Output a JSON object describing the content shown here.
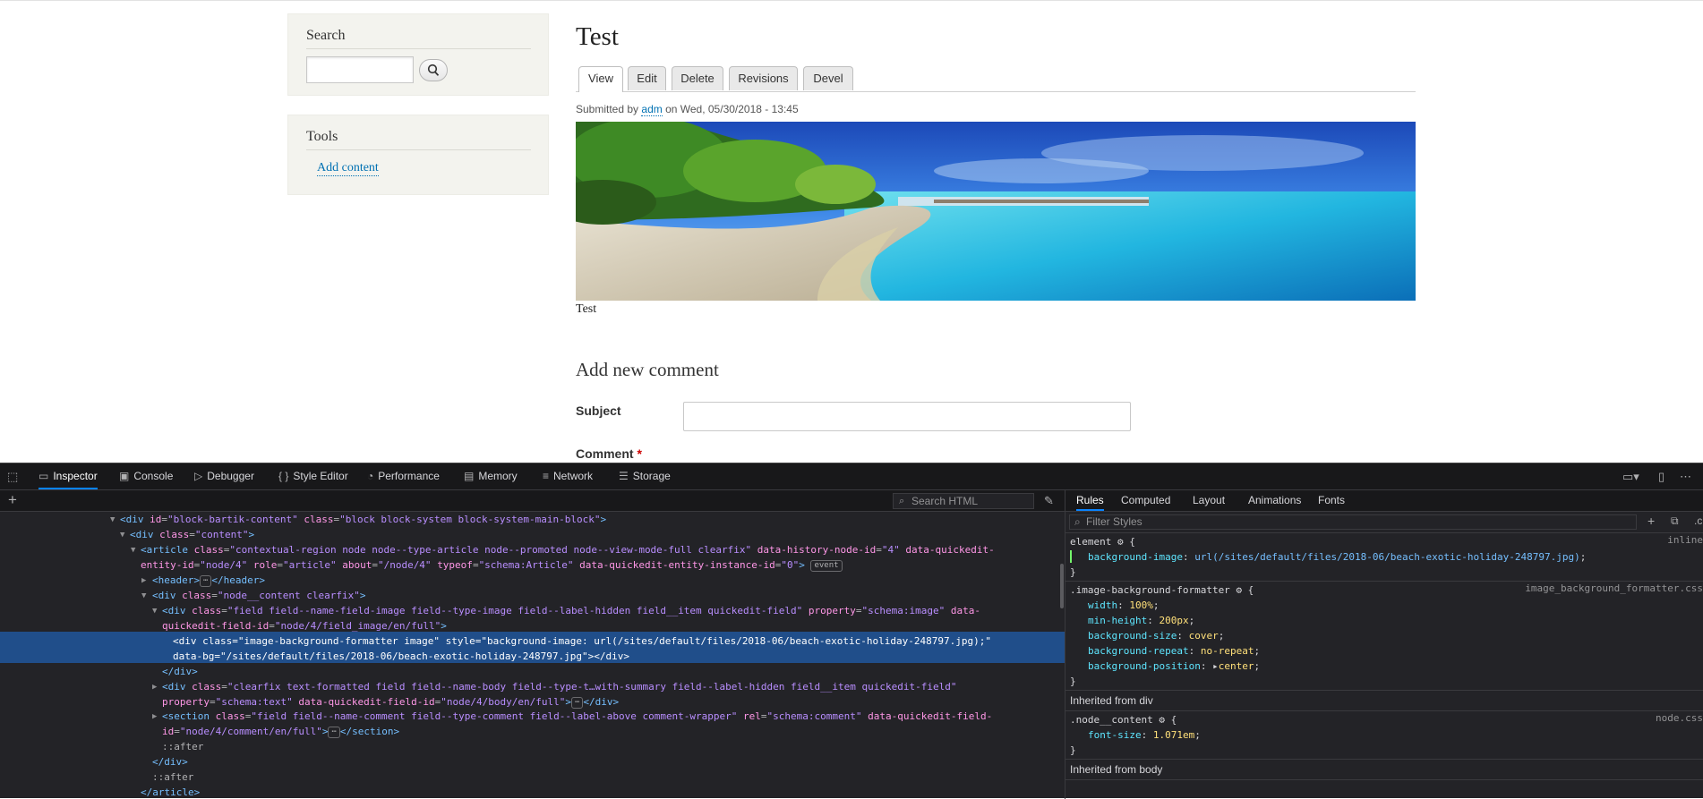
{
  "page": {
    "search_block": {
      "title": "Search"
    },
    "tools_block": {
      "title": "Tools",
      "add_content_link": "Add content"
    },
    "title": "Test",
    "tabs": [
      "View",
      "Edit",
      "Delete",
      "Revisions",
      "Devel"
    ],
    "submitted": {
      "prefix": "Submitted by",
      "author": "adm",
      "suffix": "on Wed, 05/30/2018 - 13:45"
    },
    "image_caption": "Test",
    "comment_form": {
      "title": "Add new comment",
      "subject_label": "Subject",
      "comment_label": "Comment",
      "required_marker": "*"
    }
  },
  "devtools": {
    "tabs": [
      "Inspector",
      "Console",
      "Debugger",
      "Style Editor",
      "Performance",
      "Memory",
      "Network",
      "Storage"
    ],
    "search_html_placeholder": "Search HTML",
    "markup": {
      "l1": {
        "tag_open": "<div",
        "a1": "id",
        "v1": "\"block-bartik-content\"",
        "a2": "class",
        "v2": "\"block block-system block-system-main-block\"",
        "close": ">"
      },
      "l2": {
        "tag_open": "<div",
        "a1": "class",
        "v1": "\"content\"",
        "close": ">"
      },
      "l3a": {
        "tag_open": "<article",
        "a1": "class",
        "v1": "\"contextual-region node node--type-article node--promoted node--view-mode-full clearfix\"",
        "a2": "data-history-node-id",
        "v2": "\"4\"",
        "a3": "data-quickedit-"
      },
      "l3b": {
        "a1": "entity-id",
        "v1": "\"node/4\"",
        "a2": "role",
        "v2": "\"article\"",
        "a3": "about",
        "v3": "\"/node/4\"",
        "a4": "typeof",
        "v4": "\"schema:Article\"",
        "a5": "data-quickedit-entity-instance-id",
        "v5": "\"0\"",
        "close": ">",
        "badge": "event"
      },
      "l4": {
        "open": "<header>",
        "close": "</header>"
      },
      "l5": {
        "tag_open": "<div",
        "a1": "class",
        "v1": "\"node__content clearfix\"",
        "close": ">"
      },
      "l6a": {
        "tag_open": "<div",
        "a1": "class",
        "v1": "\"field field--name-field-image field--type-image field--label-hidden field__item quickedit-field\"",
        "a2": "property",
        "v2": "\"schema:image\"",
        "a3": "data-"
      },
      "l6b": {
        "a1": "quickedit-field-id",
        "v1": "\"node/4/field_image/en/full\"",
        "close": ">"
      },
      "l7a": {
        "tag_open": "<div",
        "a1": "class",
        "v1": "\"image-background-formatter image\"",
        "a2": "style",
        "v2": "\"background-image: url(/sites/default/files/2018-06/beach-exotic-holiday-248797.jpg);\""
      },
      "l7b": {
        "a1": "data-bg",
        "v1": "\"/sites/default/files/2018-06/beach-exotic-holiday-248797.jpg\"",
        "close": "></div>"
      },
      "l8": "</div>",
      "l9a": {
        "tag_open": "<div",
        "a1": "class",
        "v1": "\"clearfix text-formatted field field--name-body field--type-t…with-summary field--label-hidden field__item quickedit-field\""
      },
      "l9b": {
        "a1": "property",
        "v1": "\"schema:text\"",
        "a2": "data-quickedit-field-id",
        "v2": "\"node/4/body/en/full\"",
        "close": ">",
        "end": "</div>"
      },
      "l10a": {
        "tag_open": "<section",
        "a1": "class",
        "v1": "\"field field--name-comment field--type-comment field--label-above comment-wrapper\"",
        "a2": "rel",
        "v2": "\"schema:comment\"",
        "a3": "data-quickedit-field-"
      },
      "l10b": {
        "a1": "id",
        "v1": "\"node/4/comment/en/full\"",
        "close": ">",
        "end": "</section>"
      },
      "l11": "::after",
      "l12": "</div>",
      "l13": "::after",
      "l14": "</article>"
    },
    "rules_tabs": [
      "Rules",
      "Computed",
      "Layout",
      "Animations",
      "Fonts"
    ],
    "filter_placeholder": "Filter Styles",
    "rules": {
      "element_selector": "element",
      "element_source": "inline",
      "bg_prop": "background-image",
      "bg_val": "url(/sites/default/files/2018-06/beach-exotic-holiday-248797.jpg)",
      "ibf_selector": ".image-background-formatter",
      "ibf_source": "image_background_formatter.css",
      "ibf_props": [
        {
          "p": "width",
          "v": "100%"
        },
        {
          "p": "min-height",
          "v": "200px"
        },
        {
          "p": "background-size",
          "v": "cover"
        },
        {
          "p": "background-repeat",
          "v": "no-repeat"
        },
        {
          "p": "background-position",
          "v": "center"
        }
      ],
      "inherited_div": "Inherited from div",
      "nc_selector": ".node__content",
      "nc_source": "node.css",
      "nc_prop": "font-size",
      "nc_val": "1.071em",
      "inherited_body": "Inherited from body"
    }
  }
}
